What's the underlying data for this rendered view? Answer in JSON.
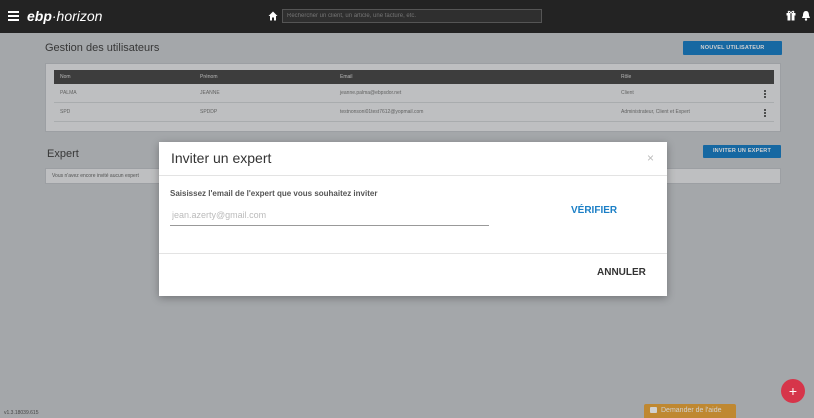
{
  "app": {
    "logo_bold": "ebp",
    "logo_rest": "·horizon"
  },
  "topbar": {
    "search_placeholder": "Rechercher un client, un article, une facture, etc."
  },
  "users": {
    "title": "Gestion des utilisateurs",
    "new_user_label": "NOUVEL UTILISATEUR",
    "columns": [
      "Nom",
      "Prénom",
      "Email",
      "Rôle"
    ],
    "rows": [
      [
        "PALMA",
        "JEANNE",
        "jeanne.palma@ebpsdor.net",
        "Client"
      ],
      [
        "SPD",
        "SPDDP",
        "testnonsoni01test7612@yopmail.com",
        "Administrateur, Client et Expert"
      ]
    ]
  },
  "expert": {
    "title": "Expert",
    "invite_label": "INVITER UN EXPERT",
    "empty_text": "Vous n'avez encore invité aucun expert"
  },
  "footer": {
    "version": "v1.3.18039.615",
    "help_label": "Demander de l'aide",
    "fab_label": "+"
  },
  "modal": {
    "title": "Inviter un expert",
    "close_symbol": "×",
    "prompt": "Saisissez l'email de l'expert que vous souhaitez inviter",
    "email_placeholder": "jean.azerty@gmail.com",
    "verify_label": "VÉRIFIER",
    "cancel_label": "ANNULER"
  },
  "colors": {
    "topbar": "#232323",
    "accent_blue": "#1b7fc6",
    "help_orange": "#e9a63c",
    "fab_red": "#d6354a"
  }
}
